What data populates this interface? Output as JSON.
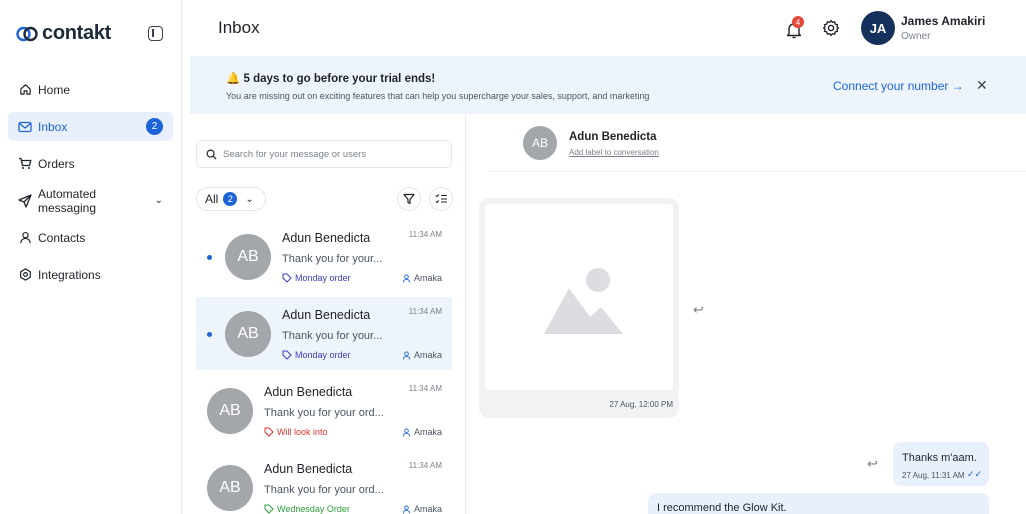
{
  "brand": {
    "name": "contakt"
  },
  "sidebar": {
    "items": [
      {
        "label": "Home",
        "icon": "home-icon"
      },
      {
        "label": "Inbox",
        "icon": "mail-icon",
        "badge": "2",
        "active": true
      },
      {
        "label": "Orders",
        "icon": "cart-icon"
      },
      {
        "label": "Automated messaging",
        "icon": "send-icon",
        "expandable": true
      },
      {
        "label": "Contacts",
        "icon": "user-icon"
      },
      {
        "label": "Integrations",
        "icon": "integrations-icon"
      }
    ]
  },
  "header": {
    "title": "Inbox",
    "notifications_count": "4",
    "user": {
      "initials": "JA",
      "name": "James Amakiri",
      "role": "Owner"
    }
  },
  "banner": {
    "emoji": "🔔",
    "title": "5 days to go before your trial ends!",
    "subtitle": "You are missing out on exciting features that can help you supercharge your sales, support, and marketing",
    "link": "Connect your number",
    "link_arrow": "→",
    "close": "✕"
  },
  "list": {
    "search_placeholder": "Search for your message or users",
    "filter": {
      "label": "All",
      "count": "2",
      "chevron": "⌄"
    },
    "conversations": [
      {
        "initials": "AB",
        "name": "Adun Benedicta",
        "time": "11:34 AM",
        "preview": "Thank you for your...",
        "tag": "Monday order",
        "tag_color": "#3a3cc8",
        "agent": "Amaka",
        "unread": true,
        "selected": false
      },
      {
        "initials": "AB",
        "name": "Adun Benedicta",
        "time": "11:34 AM",
        "preview": "Thank you for your...",
        "tag": "Monday order",
        "tag_color": "#3a3cc8",
        "agent": "Amaka",
        "unread": true,
        "selected": true
      },
      {
        "initials": "AB",
        "name": "Adun Benedicta",
        "time": "11:34 AM",
        "preview": "Thank you for your ord...",
        "tag": "Will look into",
        "tag_color": "#d8362b",
        "agent": "Amaka",
        "unread": false,
        "selected": false
      },
      {
        "initials": "AB",
        "name": "Adun Benedicta",
        "time": "11:34 AM",
        "preview": "Thank you for your ord...",
        "tag": "Wednesday Order",
        "tag_color": "#2f9e3c",
        "agent": "Amaka",
        "unread": false,
        "selected": false
      }
    ]
  },
  "chat": {
    "contact": {
      "initials": "AB",
      "name": "Adun Benedicta",
      "label_link": "Add label to conversation"
    },
    "messages": [
      {
        "type": "image",
        "time": "27 Aug, 12:00 PM"
      },
      {
        "type": "text",
        "text": "Thanks m'aam.",
        "time": "27 Aug, 11:31 AM",
        "tick": "✓✓"
      },
      {
        "type": "text",
        "text": "I recommend the Glow Kit."
      }
    ],
    "reply_glyph": "↩"
  },
  "colors": {
    "accent": "#1d64d8",
    "active_bg": "#e7f0fc",
    "banner_bg": "#eef4fc",
    "avatar": "#a3a6ab"
  }
}
